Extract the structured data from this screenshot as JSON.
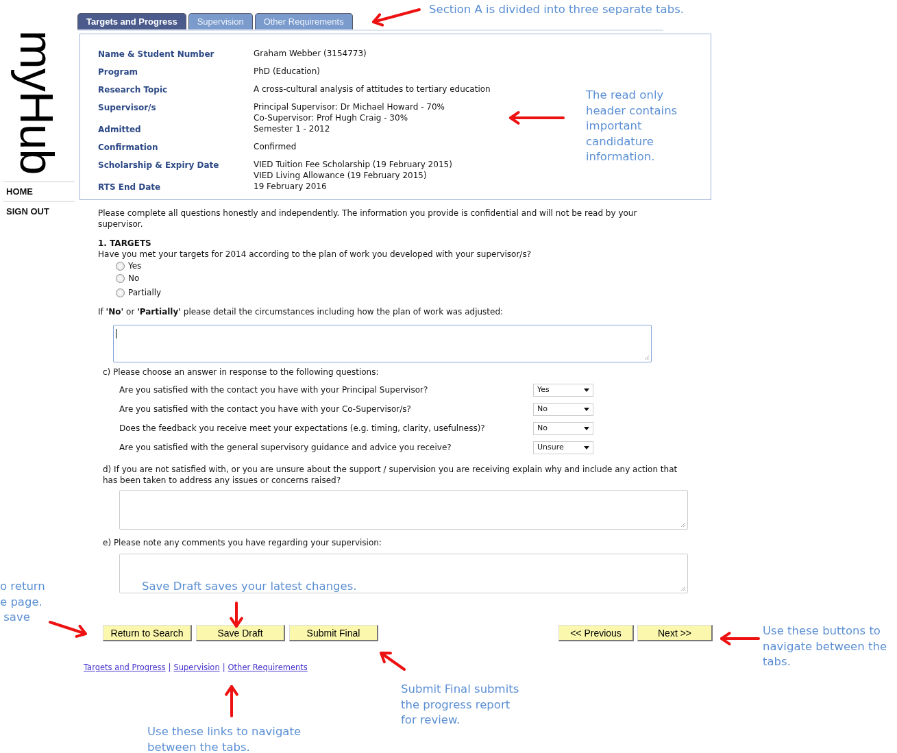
{
  "logo": "myHub",
  "nav": [
    {
      "label": "HOME"
    },
    {
      "label": "SIGN OUT"
    }
  ],
  "tabs": [
    {
      "label": "Targets and Progress",
      "selected": true
    },
    {
      "label": "Supervision",
      "selected": false
    },
    {
      "label": "Other Requirements",
      "selected": false
    }
  ],
  "header_fields": [
    {
      "label": "Name & Student Number",
      "value": [
        "Graham Webber (3154773)"
      ]
    },
    {
      "label": "Program",
      "value": [
        "PhD (Education)"
      ]
    },
    {
      "label": "Research Topic",
      "value": [
        "A cross-cultural analysis of attitudes to tertiary education"
      ]
    },
    {
      "label": "Supervisor/s",
      "value": [
        "Principal Supervisor: Dr Michael Howard - 70%",
        "Co-Supervisor: Prof Hugh Craig - 30%"
      ]
    },
    {
      "label": "Admitted",
      "value": [
        "Semester 1 - 2012"
      ]
    },
    {
      "label": "Confirmation",
      "value": [
        "Confirmed"
      ]
    },
    {
      "label": "Scholarship & Expiry Date",
      "value": [
        "VIED Tuition Fee Scholarship (19 February 2015)",
        "VIED Living Allowance (19 February 2015)"
      ]
    },
    {
      "label": "RTS End Date",
      "value": [
        "19 February 2016"
      ]
    }
  ],
  "intro": "Please complete all questions honestly and independently. The information you provide is confidential and will not be read by your supervisor.",
  "section_title": "1. TARGETS",
  "targets_question": "Have you met your targets for 2014 according to the plan of work you developed with your supervisor/s?",
  "radio_options": [
    {
      "label": "Yes",
      "selected": false
    },
    {
      "label": "No",
      "selected": false
    },
    {
      "label": "Partially",
      "selected": false
    }
  ],
  "details_prompt": "If **'No'** or **'Partially'** please detail the circumstances including how the plan of work was adjusted:",
  "details_box": {
    "focused": true
  },
  "part_c": {
    "prompt": "c) Please choose an answer in response to the following questions:",
    "questions": [
      {
        "text": "Are you satisfied with the contact you have with your Principal Supervisor?",
        "answer": "Yes"
      },
      {
        "text": "Are you satisfied with the contact you have with your Co-Supervisor/s?",
        "answer": "No"
      },
      {
        "text": "Does the feedback you receive meet your expectations (e.g. timing, clarity, usefulness)?",
        "answer": "No"
      },
      {
        "text": "Are you satisfied with the general supervisory guidance and advice you receive?",
        "answer": "Unsure"
      }
    ]
  },
  "part_d": {
    "prompt": "d) If you are not satisfied with, or you are unsure about the support / supervision you are receiving explain why and include any action that has been taken to address any issues or concerns raised?",
    "focused": false
  },
  "part_e": {
    "prompt": "e) Please note any comments you have regarding your supervision:",
    "focused": false
  },
  "action_buttons": [
    "Return to Search",
    "Save Draft",
    "Submit Final"
  ],
  "nav_buttons": [
    "<< Previous",
    "Next >>"
  ],
  "footer_links": {
    "links": [
      "Targets and Progress",
      "Supervision",
      "Other Requirements"
    ],
    "separator": "|"
  },
  "annotations": [
    "Section A is divided into three separate tabs.",
    "The read only\nheader contains\nimportant\ncandidature\ninformation.",
    "o return\ne page.\n save",
    "Save Draft saves your latest changes.",
    "Submit Final submits\nthe progress report\nfor review.",
    "Use these links to navigate\nbetween the tabs.",
    "Use these buttons to\nnavigate between the\ntabs."
  ]
}
